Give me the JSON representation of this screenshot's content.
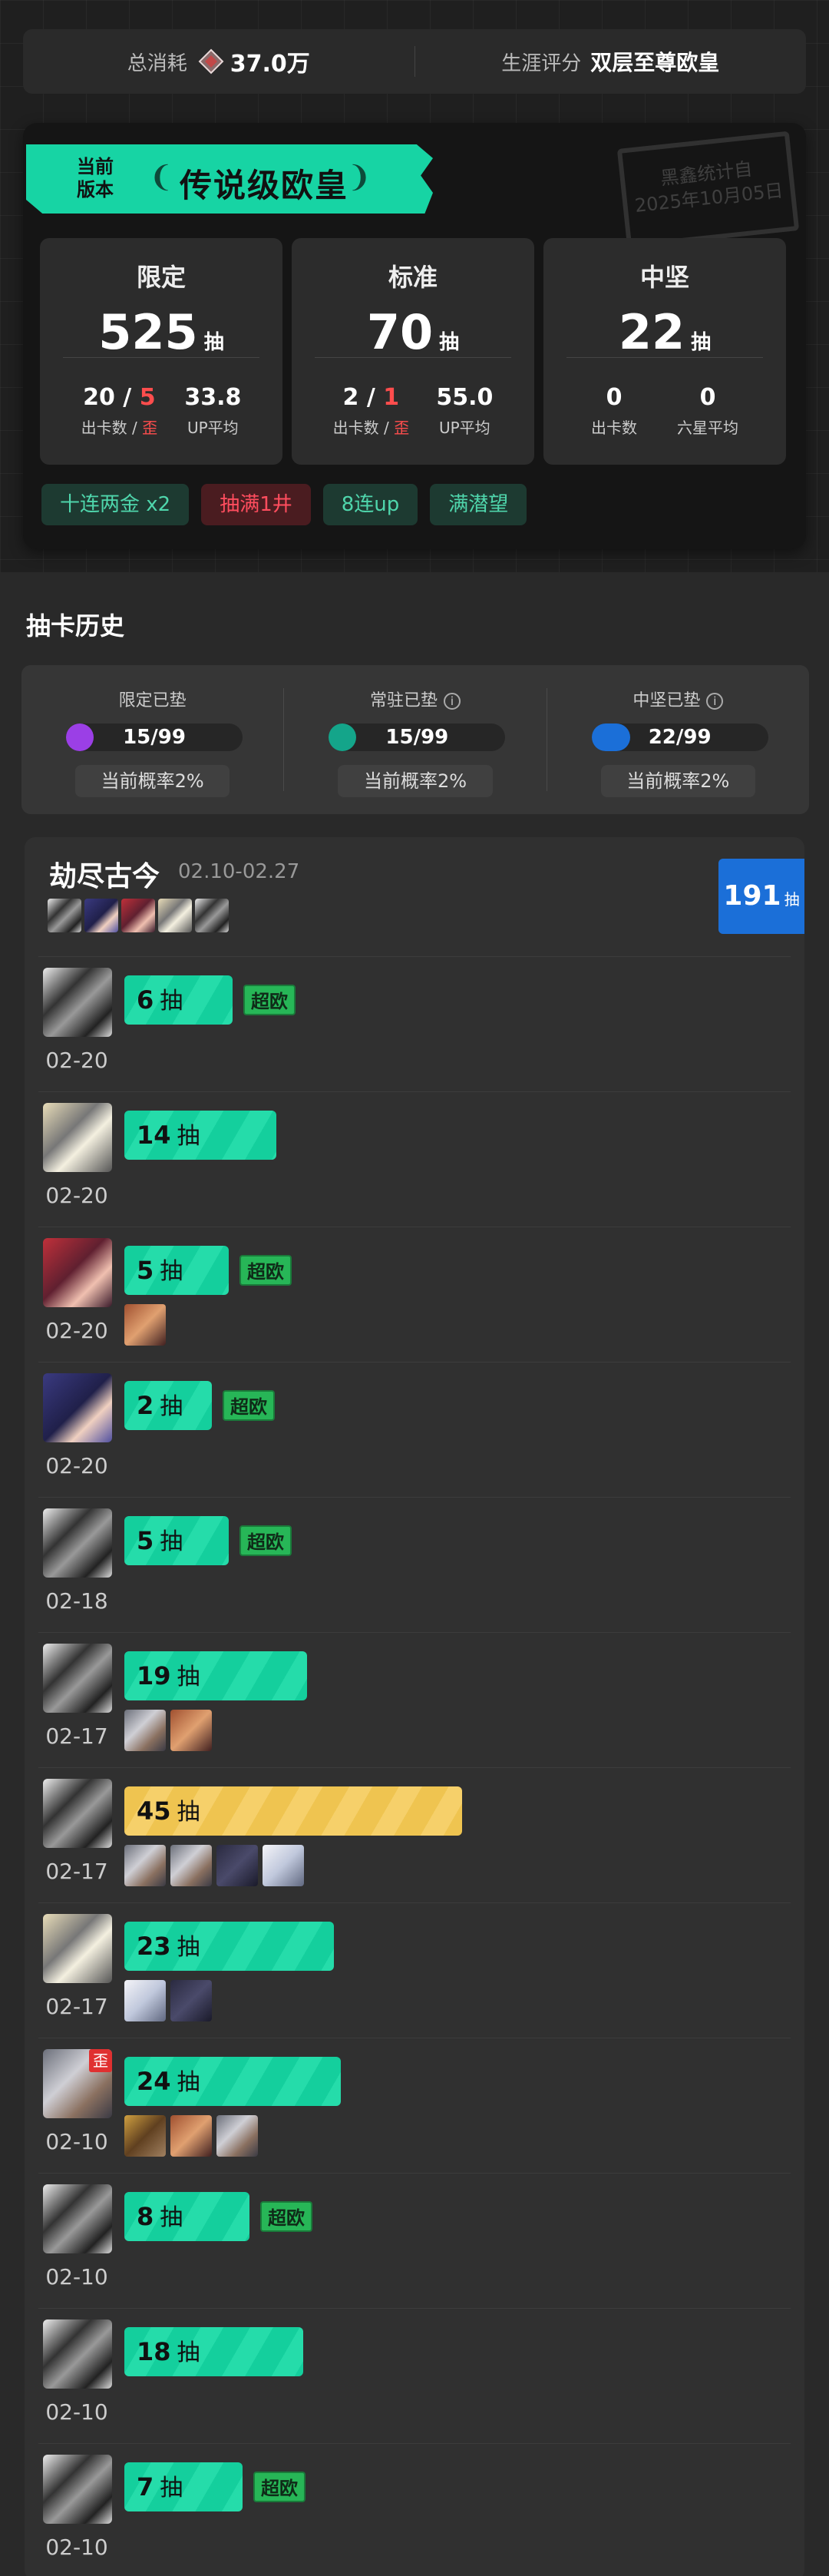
{
  "summary": {
    "spend_label": "总消耗",
    "spend_value": "37.0万",
    "rating_label": "生涯评分",
    "rating_value": "双层至尊欧皇"
  },
  "card": {
    "version_label_line1": "当前",
    "version_label_line2": "版本",
    "title": "传说级欧皇",
    "stamp_line1": "黑鑫统计自",
    "stamp_line2": "2025年10月05日",
    "stats": [
      {
        "name": "限定",
        "total": "525",
        "unit": "抽",
        "a_val": "20",
        "a_sep": " / ",
        "a_red": "5",
        "a_label": "出卡数 / ",
        "a_label_red": "歪",
        "b_val": "33.8",
        "b_label": "UP平均"
      },
      {
        "name": "标准",
        "total": "70",
        "unit": "抽",
        "a_val": "2",
        "a_sep": " / ",
        "a_red": "1",
        "a_label": "出卡数 / ",
        "a_label_red": "歪",
        "b_val": "55.0",
        "b_label": "UP平均"
      },
      {
        "name": "中坚",
        "total": "22",
        "unit": "抽",
        "a_val": "0",
        "a_sep": "",
        "a_red": "",
        "a_label": "出卡数",
        "a_label_red": "",
        "b_val": "0",
        "b_label": "六星平均"
      }
    ],
    "tags": [
      {
        "text": "十连两金  x2",
        "tone": "g"
      },
      {
        "text": "抽满1井",
        "tone": "r"
      },
      {
        "text": "8连up",
        "tone": "g"
      },
      {
        "text": "满潜望",
        "tone": "g"
      }
    ]
  },
  "history": {
    "title": "抽卡历史",
    "pity": [
      {
        "label": "限定已垫",
        "info": false,
        "value": "15/99",
        "color": "#9b3fe6",
        "prob": "当前概率2%"
      },
      {
        "label": "常驻已垫",
        "info": true,
        "value": "15/99",
        "color": "#14a58a",
        "prob": "当前概率2%"
      },
      {
        "label": "中坚已垫",
        "info": true,
        "value": "22/99",
        "color": "#1b6fd8",
        "prob": "当前概率2%"
      }
    ],
    "pool": {
      "name": "劫尽古今",
      "date": "02.10-02.27",
      "total": "191",
      "unit": "抽"
    },
    "rows": [
      {
        "count": "6",
        "unit": "抽",
        "date": "02-20",
        "chao": "超欧",
        "fraction": 0.32
      },
      {
        "count": "14",
        "unit": "抽",
        "date": "02-20",
        "chao": "",
        "fraction": 0.45
      },
      {
        "count": "5",
        "unit": "抽",
        "date": "02-20",
        "chao": "超欧",
        "fraction": 0.31
      },
      {
        "count": "2",
        "unit": "抽",
        "date": "02-20",
        "chao": "超欧",
        "fraction": 0.26
      },
      {
        "count": "5",
        "unit": "抽",
        "date": "02-18",
        "chao": "超欧",
        "fraction": 0.31
      },
      {
        "count": "19",
        "unit": "抽",
        "date": "02-17",
        "chao": "",
        "fraction": 0.54
      },
      {
        "count": "45",
        "unit": "抽",
        "date": "02-17",
        "chao": "",
        "fraction": 1.0
      },
      {
        "count": "23",
        "unit": "抽",
        "date": "02-17",
        "chao": "",
        "fraction": 0.62
      },
      {
        "count": "24",
        "unit": "抽",
        "date": "02-10",
        "chao": "",
        "fraction": 0.64,
        "wai": "歪"
      },
      {
        "count": "8",
        "unit": "抽",
        "date": "02-10",
        "chao": "超欧",
        "fraction": 0.37
      },
      {
        "count": "18",
        "unit": "抽",
        "date": "02-10",
        "chao": "",
        "fraction": 0.53
      },
      {
        "count": "7",
        "unit": "抽",
        "date": "02-10",
        "chao": "超欧",
        "fraction": 0.35
      }
    ]
  }
}
